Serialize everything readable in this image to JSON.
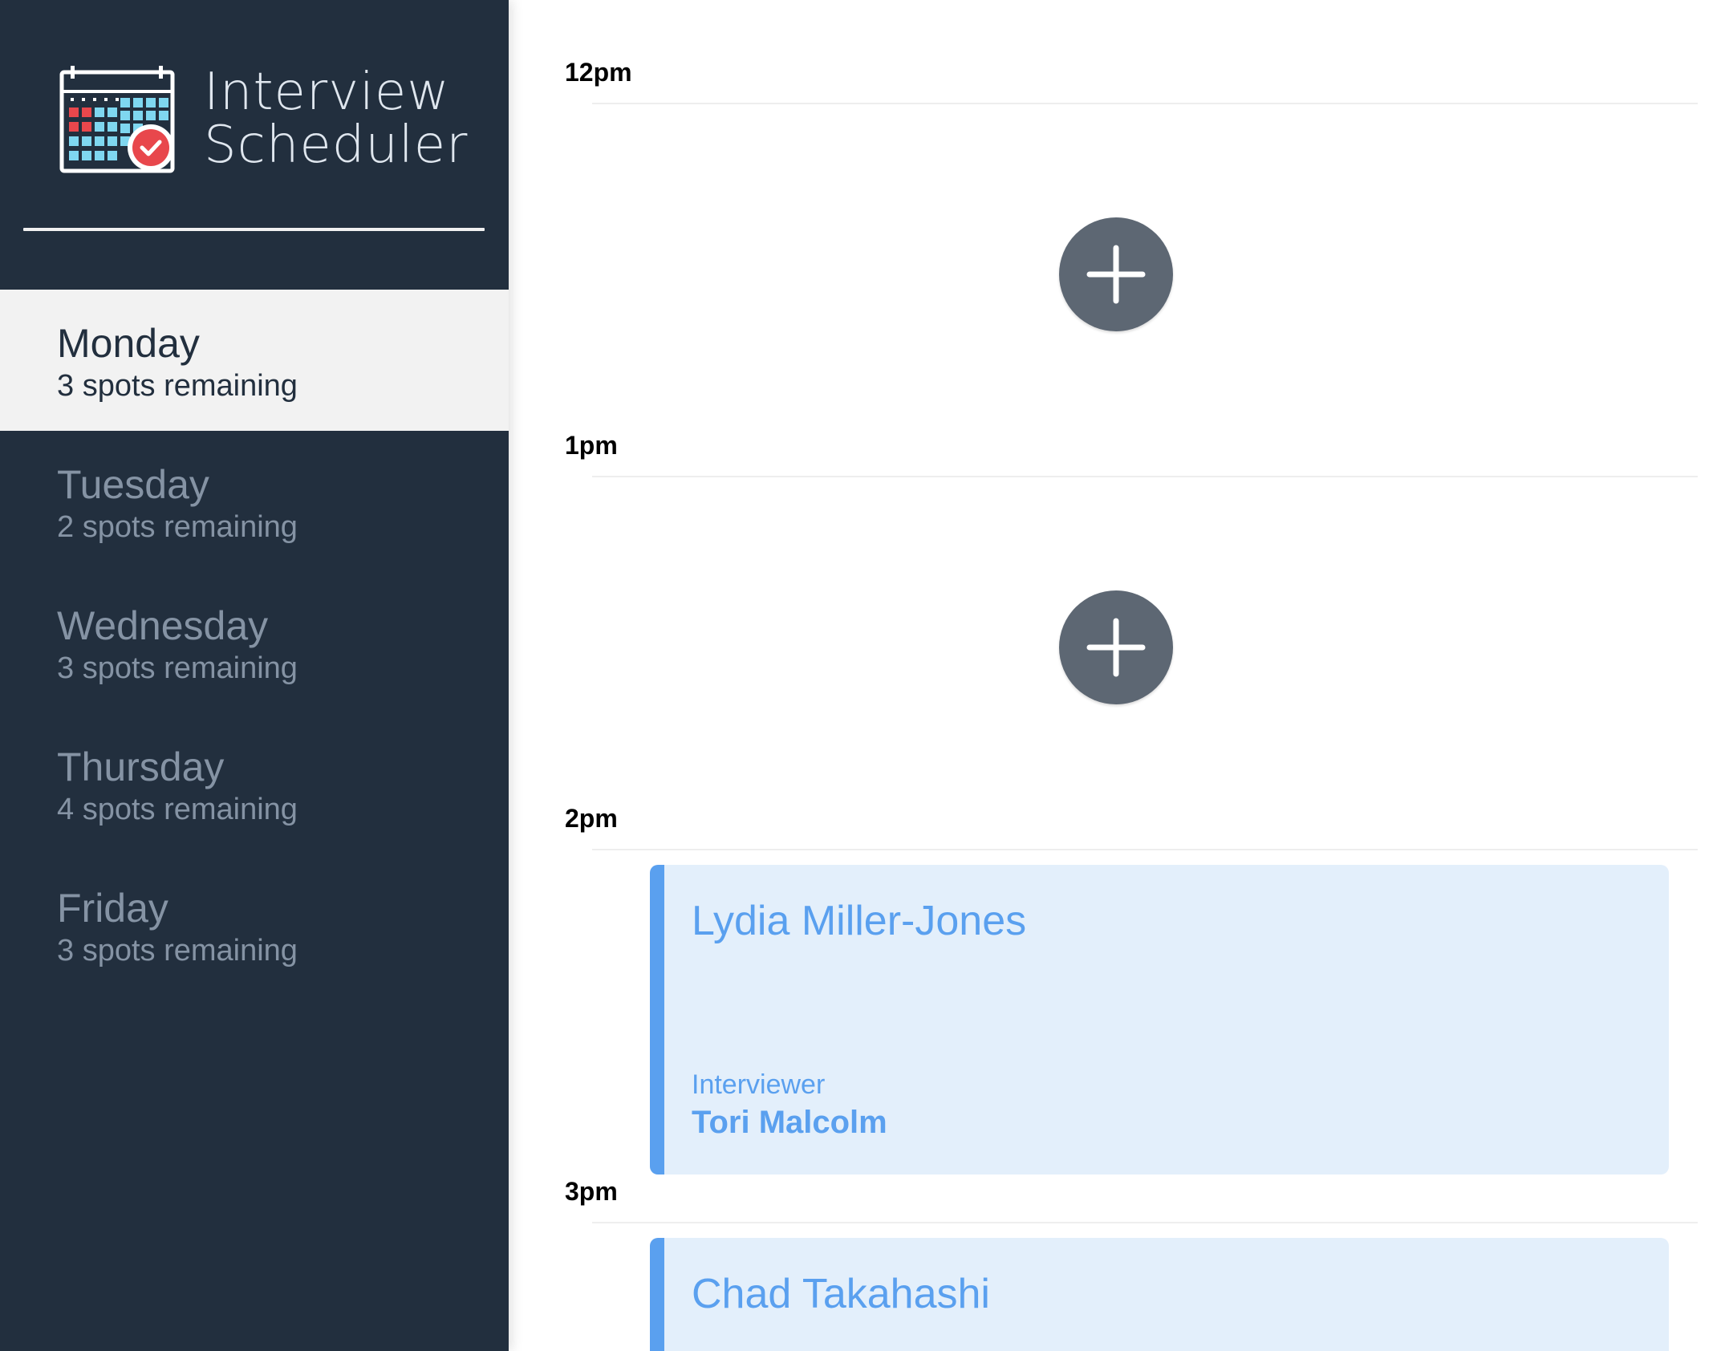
{
  "app": {
    "title_line1": "Interview",
    "title_line2": "Scheduler",
    "logo_icon": "calendar-check-icon"
  },
  "days": [
    {
      "name": "Monday",
      "spots": "3 spots remaining",
      "selected": true
    },
    {
      "name": "Tuesday",
      "spots": "2 spots remaining",
      "selected": false
    },
    {
      "name": "Wednesday",
      "spots": "3 spots remaining",
      "selected": false
    },
    {
      "name": "Thursday",
      "spots": "4 spots remaining",
      "selected": false
    },
    {
      "name": "Friday",
      "spots": "3 spots remaining",
      "selected": false
    }
  ],
  "schedule": {
    "slots": [
      {
        "time": "12pm",
        "empty": true,
        "add_icon": "plus-icon"
      },
      {
        "time": "1pm",
        "empty": true,
        "add_icon": "plus-icon"
      },
      {
        "time": "2pm",
        "empty": false,
        "student": "Lydia Miller-Jones",
        "interviewer_label": "Interviewer",
        "interviewer": "Tori Malcolm"
      },
      {
        "time": "3pm",
        "empty": false,
        "student": "Chad Takahashi"
      }
    ]
  },
  "colors": {
    "sidebar_bg": "#222f3e",
    "selected_bg": "#f2f2f2",
    "accent_blue": "#5aa0ef",
    "appointment_bg": "#e3effb",
    "add_button": "#5d6773"
  }
}
